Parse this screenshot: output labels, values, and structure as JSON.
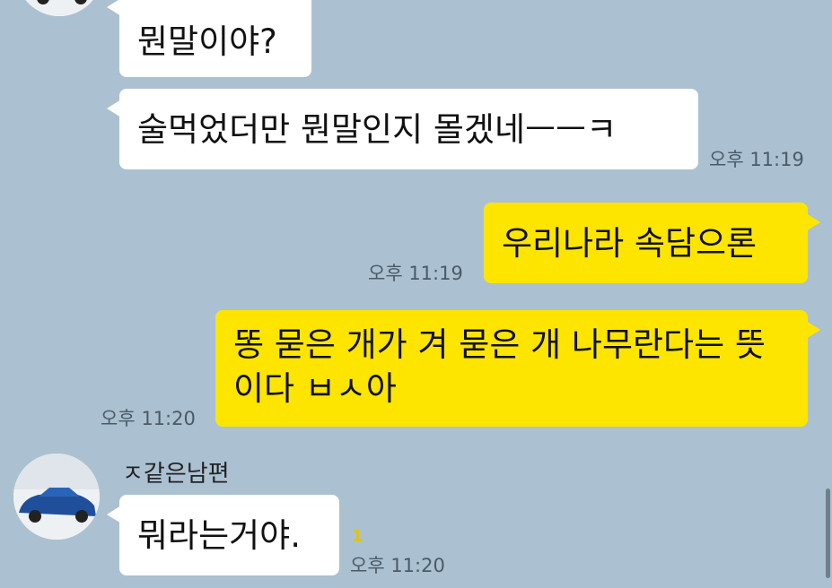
{
  "conversation": {
    "messages": [
      {
        "from": "other",
        "text": "뭔말이야?"
      },
      {
        "from": "other",
        "text": "술먹었더만 뭔말인지 몰겠네ㅡㅡㅋ",
        "time": "오후 11:19"
      },
      {
        "from": "me",
        "text": "우리나라 속담으론",
        "time": "오후 11:19"
      },
      {
        "from": "me",
        "text": "똥 묻은 개가 겨 묻은 개 나무란다는 뜻이다 ㅂㅅ아",
        "time": "오후 11:20"
      },
      {
        "from": "other",
        "sender": "ㅈ같은남편",
        "text": "뭐라는거야.",
        "unread": "1",
        "time": "오후 11:20"
      }
    ]
  },
  "colors": {
    "background": "#abc1d1",
    "incoming_bubble": "#ffffff",
    "outgoing_bubble": "#fee500",
    "unread_badge": "#e6c300"
  },
  "icons": {
    "avatar": "blue-car-profile-photo"
  }
}
